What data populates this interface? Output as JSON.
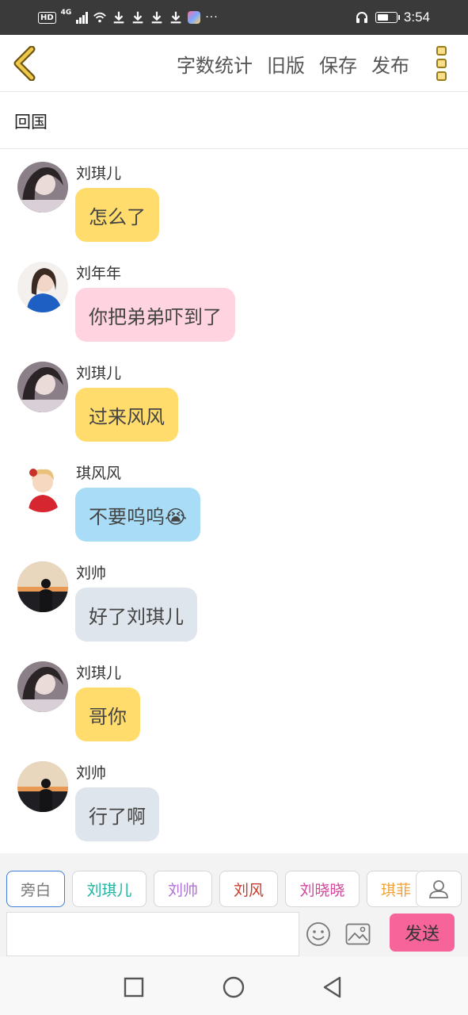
{
  "status_bar": {
    "hd": "HD",
    "network": "4G",
    "more": "···",
    "time": "3:54",
    "battery_percent": 60
  },
  "header": {
    "back_icon": "chevron-left-icon",
    "menu": [
      "字数统计",
      "旧版",
      "保存",
      "发布"
    ],
    "more_icon": "kebab-menu-icon",
    "accent_color": "#f0c84a"
  },
  "title": "回国",
  "messages": [
    {
      "name": "刘琪儿",
      "text": "怎么了",
      "color": "#ffdc6b",
      "avatar": "dark-hair-girl"
    },
    {
      "name": "刘年年",
      "text": "你把弟弟吓到了",
      "color": "#ffd3e0",
      "avatar": "girl-blue-shirt"
    },
    {
      "name": "刘琪儿",
      "text": "过来风风",
      "color": "#ffdc6b",
      "avatar": "dark-hair-girl"
    },
    {
      "name": "琪风风",
      "text": "不要呜呜😭",
      "color": "#a9ddf7",
      "avatar": "toddler-red"
    },
    {
      "name": "刘帅",
      "text": "好了刘琪儿",
      "color": "#dfe5ec",
      "avatar": "sunset-silhouette"
    },
    {
      "name": "刘琪儿",
      "text": "哥你",
      "color": "#ffdc6b",
      "avatar": "dark-hair-girl"
    },
    {
      "name": "刘帅",
      "text": "行了啊",
      "color": "#dfe5ec",
      "avatar": "sunset-silhouette"
    }
  ],
  "characters": [
    {
      "name": "旁白",
      "color": "#777777",
      "selected": true
    },
    {
      "name": "刘琪儿",
      "color": "#1fb5a0",
      "selected": false
    },
    {
      "name": "刘帅",
      "color": "#b072d8",
      "selected": false
    },
    {
      "name": "刘风",
      "color": "#c83a2c",
      "selected": false
    },
    {
      "name": "刘晓晓",
      "color": "#d2479a",
      "selected": false
    },
    {
      "name": "琪菲",
      "color": "#f0a23a",
      "selected": false
    }
  ],
  "input": {
    "value": "",
    "placeholder": ""
  },
  "send_label": "发送",
  "icons": {
    "person": "person-icon",
    "emoji": "smiley-icon",
    "image": "image-icon"
  },
  "nav": [
    "square-icon",
    "circle-icon",
    "triangle-back-icon"
  ]
}
